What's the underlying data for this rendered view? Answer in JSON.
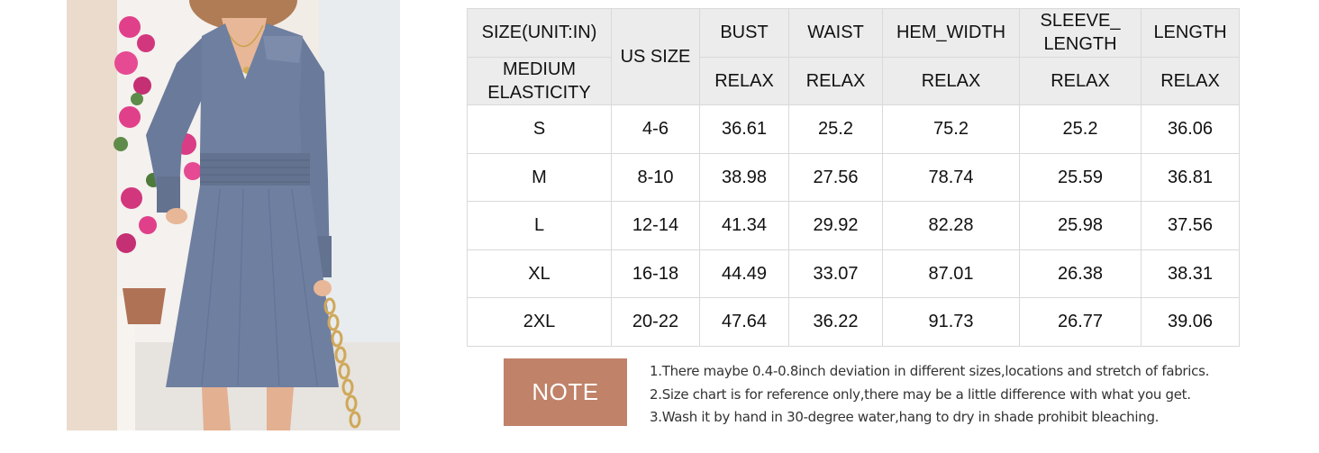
{
  "product_image": {
    "alt": "Model wearing a blue-grey long-sleeve V-neck dress with smocked waist"
  },
  "size_table": {
    "header_top": {
      "size_label": "SIZE(UNIT:IN)",
      "us_size": "US SIZE",
      "columns": [
        "BUST",
        "WAIST",
        "HEM_WIDTH",
        "SLEEVE_ LENGTH",
        "LENGTH"
      ]
    },
    "header_bottom": {
      "elasticity": "MEDIUM ELASTICITY",
      "fit": [
        "RELAX",
        "RELAX",
        "RELAX",
        "RELAX",
        "RELAX"
      ]
    },
    "rows": [
      {
        "size": "S",
        "us": "4-6",
        "values": [
          "36.61",
          "25.2",
          "75.2",
          "25.2",
          "36.06"
        ]
      },
      {
        "size": "M",
        "us": "8-10",
        "values": [
          "38.98",
          "27.56",
          "78.74",
          "25.59",
          "36.81"
        ]
      },
      {
        "size": "L",
        "us": "12-14",
        "values": [
          "41.34",
          "29.92",
          "82.28",
          "25.98",
          "37.56"
        ]
      },
      {
        "size": "XL",
        "us": "16-18",
        "values": [
          "44.49",
          "33.07",
          "87.01",
          "26.38",
          "38.31"
        ]
      },
      {
        "size": "2XL",
        "us": "20-22",
        "values": [
          "47.64",
          "36.22",
          "91.73",
          "26.77",
          "39.06"
        ]
      }
    ]
  },
  "note": {
    "label": "NOTE",
    "items": [
      "1.There maybe 0.4-0.8inch deviation in different sizes,locations and stretch of fabrics.",
      "2.Size chart is for reference only,there may be a little difference with what you get.",
      "3.Wash it by hand in 30-degree water,hang to dry in shade prohibit bleaching."
    ]
  },
  "colors": {
    "note_bg": "#c08269",
    "header_bg": "#ececec",
    "border": "#d9d9d9",
    "dress": "#6f7fa0"
  }
}
